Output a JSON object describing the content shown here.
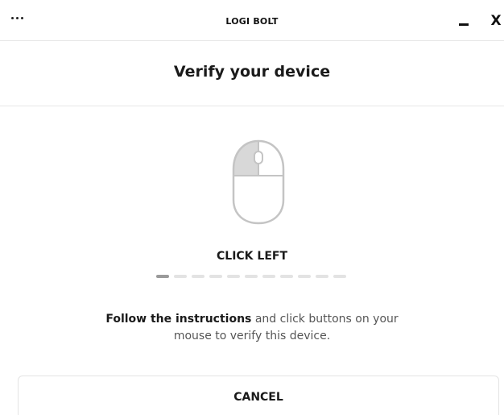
{
  "titlebar": {
    "title": "LOGI BOLT",
    "close_label": "X"
  },
  "icons": {
    "menu": "more-horizontal-icon",
    "minimize": "minimize-icon",
    "close": "close-icon",
    "mouse": "mouse-left-click-icon"
  },
  "header": {
    "title": "Verify your device"
  },
  "verification": {
    "instruction": "CLICK LEFT",
    "step_current": 1,
    "step_total": 11
  },
  "description": {
    "bold": "Follow the instructions",
    "rest_line1": " and click buttons on your",
    "line2": "mouse to verify this device."
  },
  "actions": {
    "cancel_label": "CANCEL"
  },
  "colors": {
    "highlight": "#d8d8d8",
    "outline": "#c4c4c4",
    "progress_active": "#9a9a9a",
    "progress_inactive": "#e3e3e3"
  }
}
